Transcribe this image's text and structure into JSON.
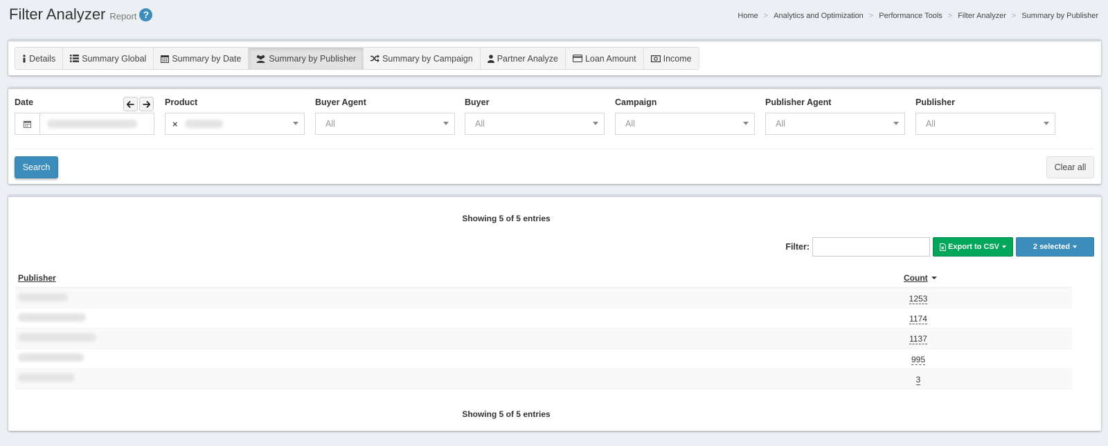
{
  "header": {
    "title": "Filter Analyzer",
    "subtitle": "Report",
    "help_glyph": "?",
    "breadcrumb": [
      "Home",
      "Analytics and Optimization",
      "Performance Tools",
      "Filter Analyzer",
      "Summary by Publisher"
    ]
  },
  "tabs": [
    {
      "label": "Details",
      "icon": "info-icon",
      "active": false
    },
    {
      "label": "Summary Global",
      "icon": "list-icon",
      "active": false
    },
    {
      "label": "Summary by Date",
      "icon": "calendar-icon",
      "active": false
    },
    {
      "label": "Summary by Publisher",
      "icon": "users-icon",
      "active": true
    },
    {
      "label": "Summary by Campaign",
      "icon": "shuffle-icon",
      "active": false
    },
    {
      "label": "Partner Analyze",
      "icon": "user-icon",
      "active": false
    },
    {
      "label": "Loan Amount",
      "icon": "credit-card-icon",
      "active": false
    },
    {
      "label": "Income",
      "icon": "money-icon",
      "active": false
    }
  ],
  "filters": {
    "date": {
      "label": "Date",
      "value": ""
    },
    "product": {
      "label": "Product",
      "value": ""
    },
    "buyer_agent": {
      "label": "Buyer Agent",
      "value": "All"
    },
    "buyer": {
      "label": "Buyer",
      "value": "All"
    },
    "campaign": {
      "label": "Campaign",
      "value": "All"
    },
    "publisher_agent": {
      "label": "Publisher Agent",
      "value": "All"
    },
    "publisher": {
      "label": "Publisher",
      "value": "All"
    },
    "search_label": "Search",
    "clear_label": "Clear all"
  },
  "results": {
    "showing_text": "Showing 5 of 5 entries",
    "filter_label": "Filter:",
    "filter_value": "",
    "export_label": "Export to CSV",
    "selected_label": "2 selected",
    "columns": [
      "Publisher",
      "Count"
    ],
    "rows": [
      {
        "publisher": "",
        "count": "1253"
      },
      {
        "publisher": "",
        "count": "1174"
      },
      {
        "publisher": "",
        "count": "1137"
      },
      {
        "publisher": "",
        "count": "995"
      },
      {
        "publisher": "",
        "count": "3"
      }
    ]
  },
  "colors": {
    "primary": "#3c8dbc",
    "success": "#00a65a",
    "background": "#ecf0f5"
  }
}
